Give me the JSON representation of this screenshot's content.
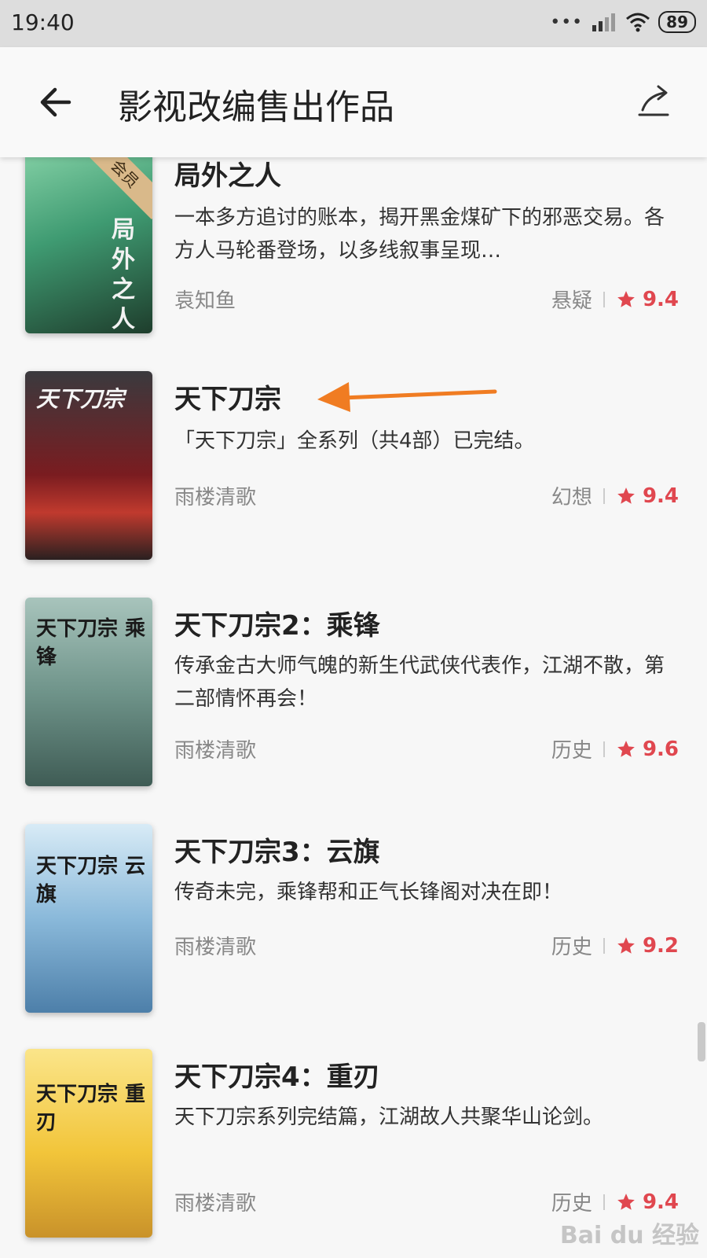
{
  "status_bar": {
    "time": "19:40",
    "battery": "89"
  },
  "app_bar": {
    "title": "影视改编售出作品"
  },
  "books": [
    {
      "title": "局外之人",
      "description": "一本多方追讨的账本，揭开黑金煤矿下的邪恶交易。各方人马轮番登场，以多线叙事呈现…",
      "author": "袁知鱼",
      "genre": "悬疑",
      "score": "9.4",
      "cover_text": "局外之人",
      "cover_badge": "会员"
    },
    {
      "title": "天下刀宗",
      "description": "「天下刀宗」全系列（共4部）已完结。",
      "author": "雨楼清歌",
      "genre": "幻想",
      "score": "9.4",
      "cover_text": "天下刀宗"
    },
    {
      "title": "天下刀宗2：乘锋",
      "description": "传承金古大师气魄的新生代武侠代表作，江湖不散，第二部情怀再会！",
      "author": "雨楼清歌",
      "genre": "历史",
      "score": "9.6",
      "cover_text": "天下刀宗 乘锋"
    },
    {
      "title": "天下刀宗3：云旗",
      "description": "传奇未完，乘锋帮和正气长锋阁对决在即！",
      "author": "雨楼清歌",
      "genre": "历史",
      "score": "9.2",
      "cover_text": "天下刀宗 云旗"
    },
    {
      "title": "天下刀宗4：重刃",
      "description": "天下刀宗系列完结篇，江湖故人共聚华山论剑。",
      "author": "雨楼清歌",
      "genre": "历史",
      "score": "9.4",
      "cover_text": "天下刀宗 重刃"
    }
  ],
  "watermark": "Bai du 经验"
}
